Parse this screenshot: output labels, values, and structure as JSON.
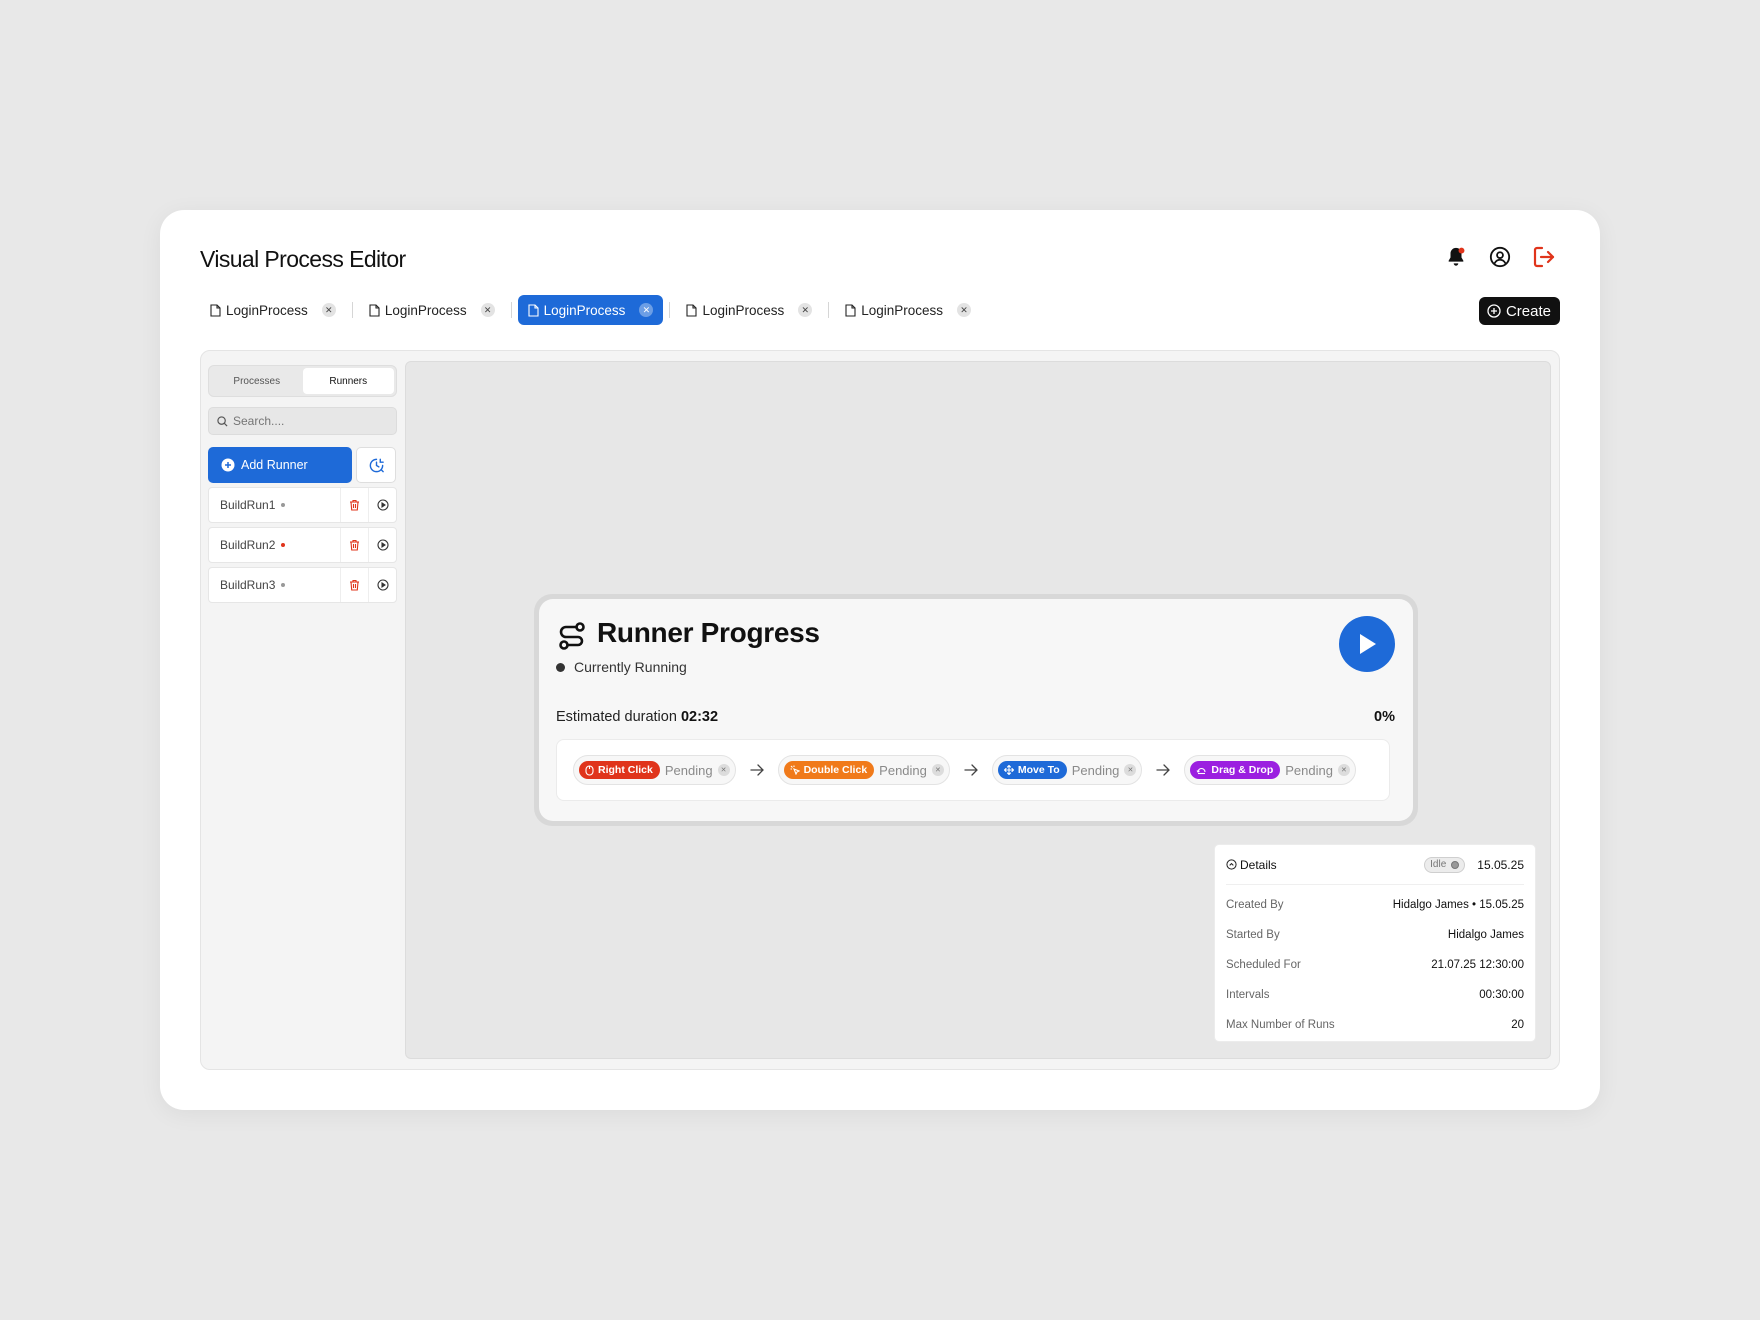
{
  "app": {
    "title": "Visual Process Editor"
  },
  "header": {
    "icons": [
      "bell-icon",
      "user-circle-icon",
      "logout-icon"
    ],
    "create_label": "Create"
  },
  "tabs": [
    {
      "label": "LoginProcess",
      "active": false
    },
    {
      "label": "LoginProcess",
      "active": false
    },
    {
      "label": "LoginProcess",
      "active": true
    },
    {
      "label": "LoginProcess",
      "active": false
    },
    {
      "label": "LoginProcess",
      "active": false
    }
  ],
  "sidebar": {
    "segments": [
      "Processes",
      "Runners"
    ],
    "active_segment": "Runners",
    "search_placeholder": "Search....",
    "add_runner_label": "Add Runner",
    "runners": [
      {
        "name": "BuildRun1",
        "status_color": "#999999"
      },
      {
        "name": "BuildRun2",
        "status_color": "#e0341b"
      },
      {
        "name": "BuildRun3",
        "status_color": "#999999"
      }
    ]
  },
  "runner_card": {
    "title": "Runner Progress",
    "status": "Currently Running",
    "duration_label": "Estimated duration",
    "duration_value": "02:32",
    "percent": "0%",
    "steps": [
      {
        "label": "Right Click",
        "state": "Pending",
        "color": "#e0341b",
        "icon": "mouse-icon"
      },
      {
        "label": "Double Click",
        "state": "Pending",
        "color": "#f07a1a",
        "icon": "pointer-click-icon"
      },
      {
        "label": "Move To",
        "state": "Pending",
        "color": "#1e6ad8",
        "icon": "move-icon"
      },
      {
        "label": "Drag & Drop",
        "state": "Pending",
        "color": "#9b1fe0",
        "icon": "drag-icon"
      }
    ]
  },
  "details": {
    "title": "Details",
    "badge": "Idle",
    "date": "15.05.25",
    "rows": [
      {
        "key": "Created By",
        "value": "Hidalgo James • 15.05.25"
      },
      {
        "key": "Started By",
        "value": "Hidalgo James"
      },
      {
        "key": "Scheduled For",
        "value": "21.07.25 12:30:00"
      },
      {
        "key": "Intervals",
        "value": "00:30:00"
      },
      {
        "key": "Max Number of Runs",
        "value": "20"
      }
    ]
  },
  "colors": {
    "accent": "#1e6ad8",
    "danger": "#e0341b",
    "dark": "#111111"
  }
}
